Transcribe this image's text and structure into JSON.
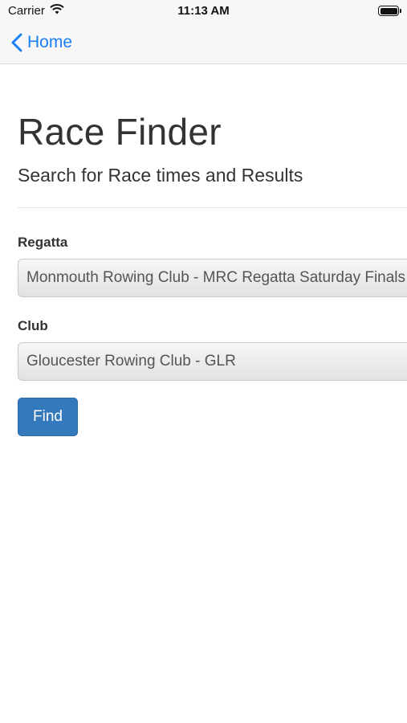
{
  "status_bar": {
    "carrier": "Carrier",
    "time": "11:13 AM"
  },
  "nav": {
    "back_label": "Home",
    "accent_color": "#1a7ff6"
  },
  "page": {
    "title": "Race Finder",
    "subtitle": "Search for Race times and Results"
  },
  "form": {
    "regatta_label": "Regatta",
    "regatta_value": "Monmouth Rowing Club - MRC Regatta Saturday Finals",
    "club_label": "Club",
    "club_value": "Gloucester Rowing Club - GLR",
    "find_label": "Find",
    "find_color": "#3579bd"
  }
}
